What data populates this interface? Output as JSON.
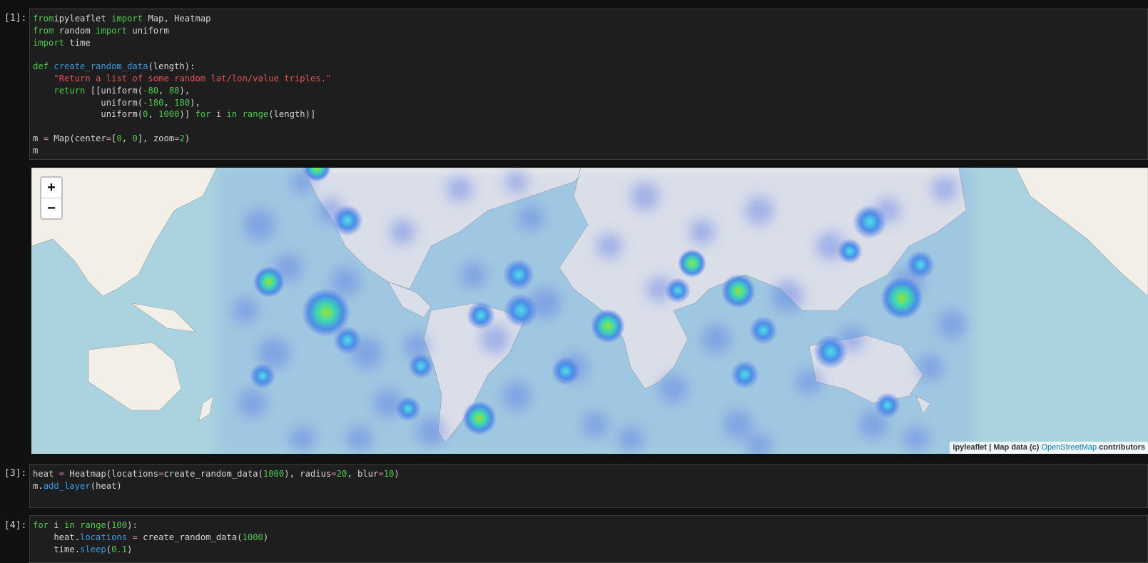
{
  "cells": [
    {
      "prompt": "[1]:",
      "lines": [
        [
          [
            "kw",
            "from"
          ],
          [
            "",
            "ipyleaflet "
          ],
          [
            "kw",
            "import"
          ],
          [
            "",
            " Map, Heatmap"
          ]
        ],
        [
          [
            "kw",
            "from"
          ],
          [
            "",
            " random "
          ],
          [
            "kw",
            "import"
          ],
          [
            "",
            " uniform"
          ]
        ],
        [
          [
            "kw",
            "import"
          ],
          [
            "",
            " time"
          ]
        ],
        [],
        [
          [
            "kw",
            "def"
          ],
          [
            "",
            " "
          ],
          [
            "fn",
            "create_random_data"
          ],
          [
            "",
            "(length):"
          ]
        ],
        [
          [
            "",
            "    "
          ],
          [
            "str",
            "\"Return a list of some random lat/lon/value triples.\""
          ]
        ],
        [
          [
            "",
            "    "
          ],
          [
            "kw",
            "return"
          ],
          [
            "",
            " [[uniform("
          ],
          [
            "op",
            "-"
          ],
          [
            "num",
            "80"
          ],
          [
            "",
            ", "
          ],
          [
            "num",
            "80"
          ],
          [
            "",
            "),"
          ]
        ],
        [
          [
            "",
            "             uniform("
          ],
          [
            "op",
            "-"
          ],
          [
            "num",
            "180"
          ],
          [
            "",
            ", "
          ],
          [
            "num",
            "180"
          ],
          [
            "",
            "),"
          ]
        ],
        [
          [
            "",
            "             uniform("
          ],
          [
            "num",
            "0"
          ],
          [
            "",
            ", "
          ],
          [
            "num",
            "1000"
          ],
          [
            "",
            ")] "
          ],
          [
            "kw",
            "for"
          ],
          [
            "",
            " i "
          ],
          [
            "kw",
            "in"
          ],
          [
            "",
            " "
          ],
          [
            "bi",
            "range"
          ],
          [
            "",
            "(length)]"
          ]
        ],
        [],
        [
          [
            "",
            "m "
          ],
          [
            "op",
            "="
          ],
          [
            "",
            " Map(center"
          ],
          [
            "op",
            "="
          ],
          [
            "",
            "["
          ],
          [
            "num",
            "0"
          ],
          [
            "",
            ", "
          ],
          [
            "num",
            "0"
          ],
          [
            "",
            "], zoom"
          ],
          [
            "op",
            "="
          ],
          [
            "num",
            "2"
          ],
          [
            "",
            ")"
          ]
        ],
        [
          [
            "",
            "m"
          ]
        ]
      ]
    },
    {
      "prompt": "[3]:",
      "lines": [
        [
          [
            "",
            "heat "
          ],
          [
            "op",
            "="
          ],
          [
            "",
            " Heatmap(locations"
          ],
          [
            "op",
            "="
          ],
          [
            "",
            "create_random_data("
          ],
          [
            "num",
            "1000"
          ],
          [
            "",
            "), radius"
          ],
          [
            "op",
            "="
          ],
          [
            "num",
            "20"
          ],
          [
            "",
            ", blur"
          ],
          [
            "op",
            "="
          ],
          [
            "num",
            "10"
          ],
          [
            "",
            ")"
          ]
        ],
        [
          [
            "",
            "m."
          ],
          [
            "fn",
            "add_layer"
          ],
          [
            "",
            "(heat)"
          ]
        ]
      ]
    },
    {
      "prompt": "[4]:",
      "lines": [
        [
          [
            "kw",
            "for"
          ],
          [
            "",
            " i "
          ],
          [
            "kw",
            "in"
          ],
          [
            "",
            " "
          ],
          [
            "bi",
            "range"
          ],
          [
            "",
            "("
          ],
          [
            "num",
            "100"
          ],
          [
            "",
            "):"
          ]
        ],
        [
          [
            "",
            "    heat."
          ],
          [
            "fn",
            "locations"
          ],
          [
            "",
            " "
          ],
          [
            "op",
            "="
          ],
          [
            "",
            " create_random_data("
          ],
          [
            "num",
            "1000"
          ],
          [
            "",
            ")"
          ]
        ],
        [
          [
            "",
            "    time."
          ],
          [
            "fn",
            "sleep"
          ],
          [
            "",
            "("
          ],
          [
            "num",
            "0.1"
          ],
          [
            "",
            ")"
          ]
        ]
      ]
    }
  ],
  "map": {
    "zoom_in_label": "+",
    "zoom_out_label": "−",
    "attribution_prefix": "ipyleaflet | Map data (c) ",
    "attribution_link": "OpenStreetMap",
    "attribution_suffix": " contributors",
    "colors": {
      "ocean": "#aad3df",
      "land": "#f2efe9",
      "heat_low": "#5a7ae8",
      "heat_mid": "#3fd9e0",
      "heat_high": "#9be22a"
    }
  }
}
